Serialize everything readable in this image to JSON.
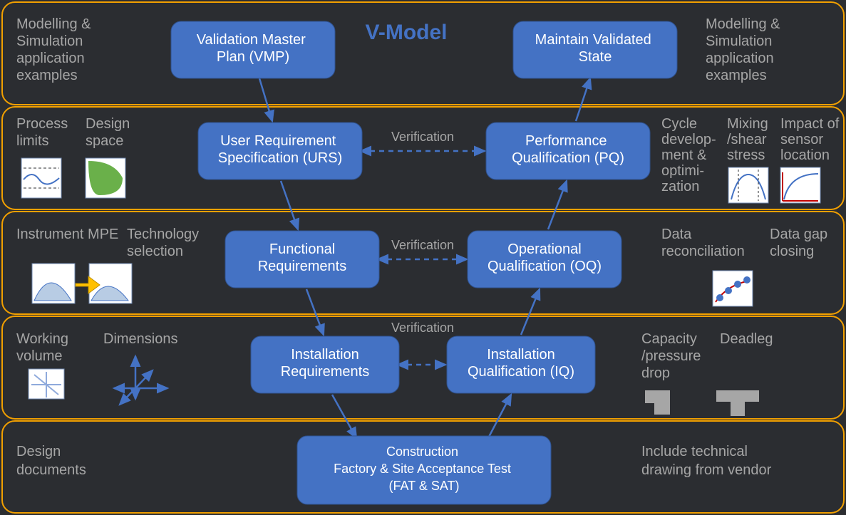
{
  "title": "V-Model",
  "left_side_header": "Modelling & Simulation application examples",
  "right_side_header": "Modelling & Simulation application examples",
  "rows": {
    "r1": {
      "left_labels": [],
      "right_labels": [],
      "left_node": "Validation Master Plan (VMP)",
      "right_node": "Maintain Validated State"
    },
    "r2": {
      "left_labels": [
        "Process limits",
        "Design space"
      ],
      "right_labels": [
        "Cycle development & optimization",
        "Mixing /shear stress",
        "Impact of sensor location"
      ],
      "left_node": "User Requirement Specification (URS)",
      "right_node": "Performance Qualification (PQ)"
    },
    "r3": {
      "left_labels": [
        "Instrument MPE",
        "Technology selection"
      ],
      "right_labels": [
        "Data reconciliation",
        "Data gap closing"
      ],
      "left_node": "Functional Requirements",
      "right_node": "Operational Qualification (OQ)"
    },
    "r4": {
      "left_labels": [
        "Working volume",
        "Dimensions"
      ],
      "right_labels": [
        "Capacity /pressure drop",
        "Deadleg"
      ],
      "left_node": "Installation Requirements",
      "right_node": "Installation Qualification (IQ)"
    },
    "r5": {
      "left_label": "Design documents",
      "right_label": "Include technical drawing from vendor",
      "center_node": "Construction\nFactory & Site Acceptance Test\n(FAT & SAT)"
    }
  },
  "verification_label": "Verification"
}
